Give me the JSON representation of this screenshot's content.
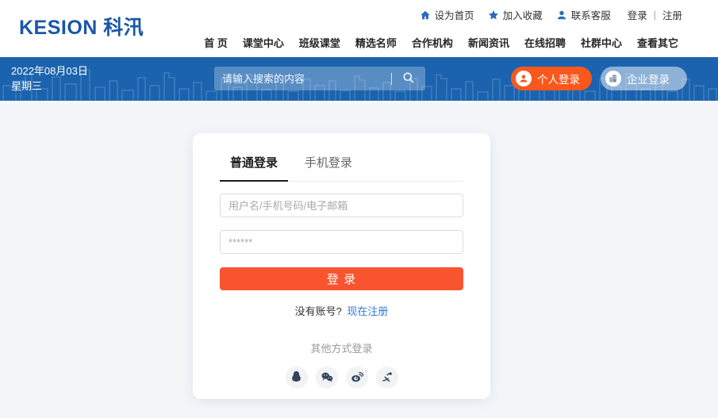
{
  "header": {
    "logo_text": "KESION 科汛",
    "utility": {
      "set_home": "设为首页",
      "add_favorite": "加入收藏",
      "contact_service": "联系客服",
      "login": "登录",
      "separator": "|",
      "register": "注册"
    },
    "nav_items": [
      "首 页",
      "课堂中心",
      "班级课堂",
      "精选名师",
      "合作机构",
      "新闻资讯",
      "在线招聘",
      "社群中心",
      "查看其它"
    ]
  },
  "banner": {
    "date_line1": "2022年08月03日",
    "weekday": "星期三",
    "search_placeholder": "请输入搜索的内容",
    "personal_login": "个人登录",
    "enterprise_login": "企业登录"
  },
  "login_card": {
    "tabs": [
      {
        "label": "普通登录",
        "active": true
      },
      {
        "label": "手机登录",
        "active": false
      }
    ],
    "username_placeholder": "用户名/手机号码/电子邮箱",
    "password_placeholder": "******",
    "login_button": "登 录",
    "no_account": "没有账号?",
    "register_now": "现在注册",
    "other_login": "其他方式登录",
    "social_icons": [
      "qq-icon",
      "wechat-icon",
      "weibo-icon",
      "alipay-icon"
    ]
  },
  "colors": {
    "banner_blue": "#1b63ae",
    "logo_blue": "#1a57a8",
    "accent_orange": "#f9581d",
    "login_button_orange": "#f95430",
    "link_blue": "#2f7bd9",
    "page_background": "#f3f5f9"
  }
}
